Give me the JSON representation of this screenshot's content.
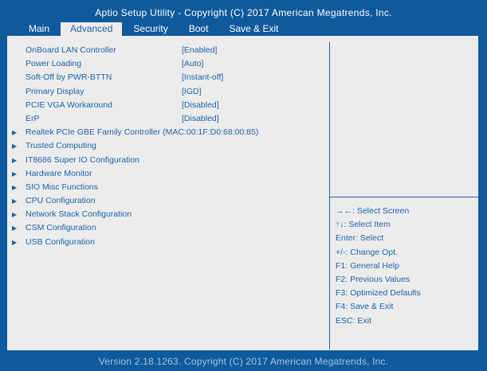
{
  "header": {
    "title": "Aptio Setup Utility - Copyright (C) 2017 American Megatrends, Inc."
  },
  "tabs": [
    {
      "label": "Main"
    },
    {
      "label": "Advanced"
    },
    {
      "label": "Security"
    },
    {
      "label": "Boot"
    },
    {
      "label": "Save & Exit"
    }
  ],
  "settings": [
    {
      "label": "OnBoard LAN Controller",
      "value": "[Enabled]"
    },
    {
      "label": "Power Loading",
      "value": "[Auto]"
    },
    {
      "label": "Soft-Off by PWR-BTTN",
      "value": "[Instant-off]"
    },
    {
      "label": "Primary Display",
      "value": "[IGD]"
    },
    {
      "label": "PCIE VGA Workaround",
      "value": "[Disabled]"
    },
    {
      "label": "ErP",
      "value": "[Disabled]"
    }
  ],
  "submenus": [
    {
      "label": "Realtek PCIe GBE Family Controller (MAC:00:1F:D0:68:00:85)"
    },
    {
      "label": "Trusted Computing"
    },
    {
      "label": "IT8686 Super IO Configuration"
    },
    {
      "label": "Hardware Monitor"
    },
    {
      "label": "SIO Misc Functions"
    },
    {
      "label": "CPU Configuration"
    },
    {
      "label": "Network Stack Configuration"
    },
    {
      "label": "CSM Configuration"
    },
    {
      "label": "USB Configuration"
    }
  ],
  "help": [
    "→←: Select Screen",
    "↑↓: Select Item",
    "Enter: Select",
    "+/-: Change Opt.",
    "F1: General Help",
    "F2: Previous Values",
    "F3: Optimized Defaults",
    "F4: Save & Exit",
    "ESC: Exit"
  ],
  "footer": {
    "text": "Version 2.18.1263. Copyright (C) 2017 American Megatrends, Inc."
  },
  "colors": {
    "background": "#0e5a9c",
    "panel": "#ececec",
    "text": "#1d62a8"
  },
  "icons": {
    "submenu": "triangle-right-icon"
  }
}
